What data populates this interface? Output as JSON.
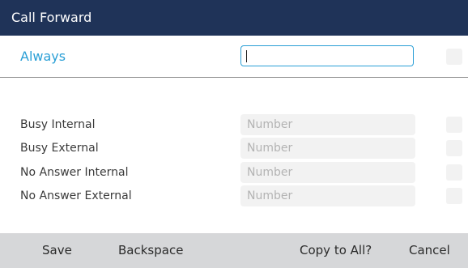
{
  "title": "Call Forward",
  "always": {
    "label": "Always",
    "value": ""
  },
  "rows": [
    {
      "label": "Busy Internal",
      "placeholder": "Number"
    },
    {
      "label": "Busy External",
      "placeholder": "Number"
    },
    {
      "label": "No Answer Internal",
      "placeholder": "Number"
    },
    {
      "label": "No Answer External",
      "placeholder": "Number"
    }
  ],
  "softkeys": {
    "save": "Save",
    "backspace": "Backspace",
    "copy_to_all": "Copy to All?",
    "cancel": "Cancel"
  },
  "colors": {
    "titlebar": "#1f3358",
    "accent": "#2a9fd6",
    "softkey_bar": "#d6d7d9"
  }
}
